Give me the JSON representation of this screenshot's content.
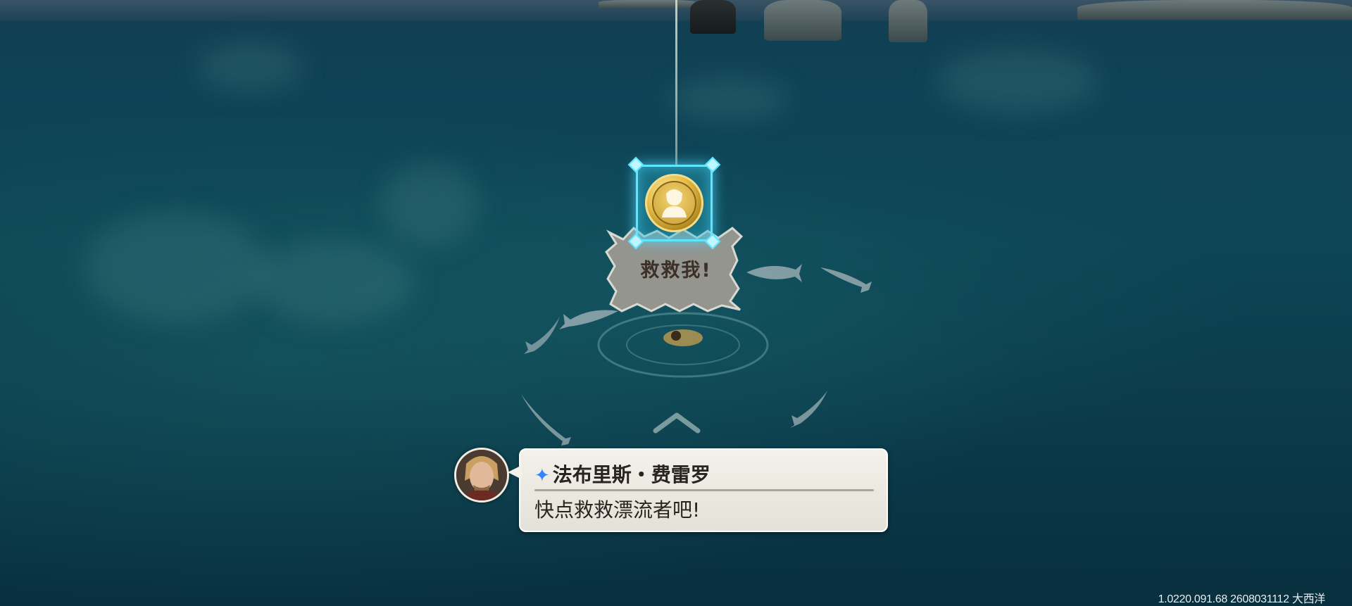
{
  "marker": {
    "icon": "survivor-portrait-icon"
  },
  "shout": {
    "text": "救救我!"
  },
  "dialogue": {
    "speaker_marker": "✦",
    "speaker": "法布里斯・费雷罗",
    "line": "快点救救漂流者吧!"
  },
  "footer": {
    "version": "1.0220.091.68 2608031112 大西洋"
  },
  "colors": {
    "marker_glow": "#5fe6ff",
    "speaker_star": "#2f86ff",
    "bubble_bg": "#f3f1ea"
  }
}
